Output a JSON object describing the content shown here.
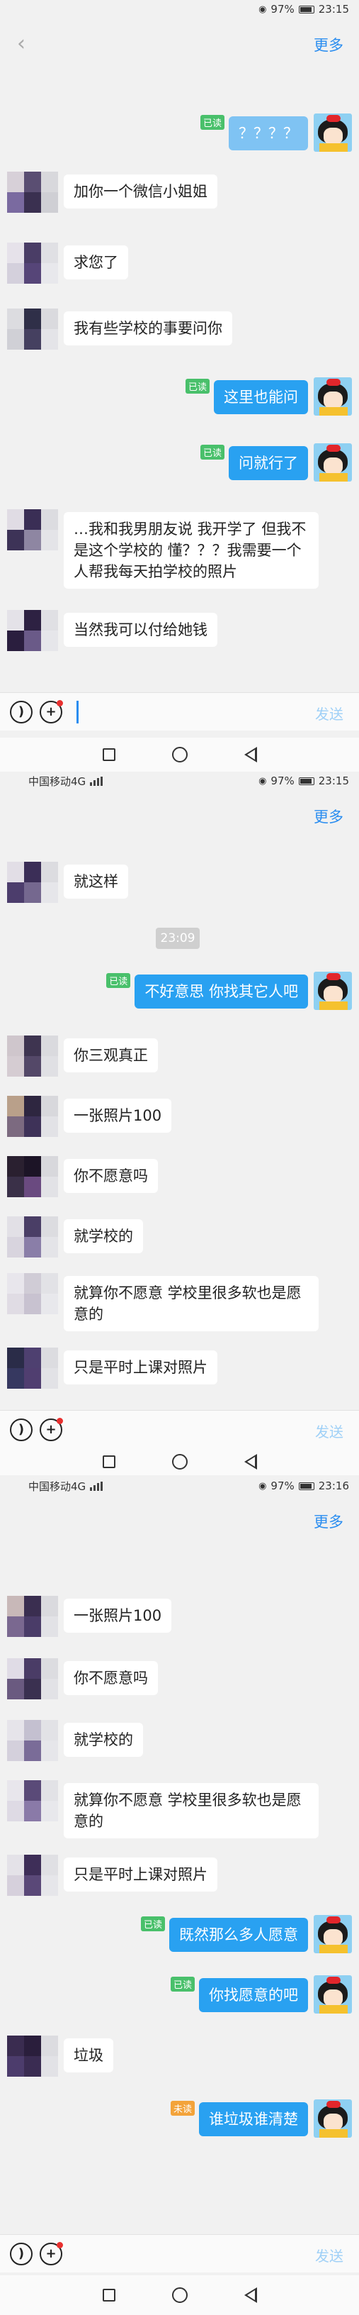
{
  "colors": {
    "accent": "#2a8df0",
    "bubble_out": "#29a1f1",
    "read_badge": "#49c06b",
    "unread_badge": "#f3a33a"
  },
  "screens": [
    {
      "status": {
        "carrier": "",
        "battery": "97%",
        "time": "23:15"
      },
      "more": "更多",
      "messages": [
        {
          "side": "right",
          "text": "？？？？",
          "badge": "已读"
        },
        {
          "side": "left",
          "text": "加你一个微信小姐姐"
        },
        {
          "side": "left",
          "text": "求您了"
        },
        {
          "side": "left",
          "text": "我有些学校的事要问你"
        },
        {
          "side": "right",
          "text": "这里也能问",
          "badge": "已读"
        },
        {
          "side": "right",
          "text": "问就行了",
          "badge": "已读"
        },
        {
          "side": "left",
          "text": "…我和我男朋友说 我开学了 但我不是这个学校的 懂？？？我需要一个人帮我每天拍学校的照片"
        },
        {
          "side": "left",
          "text": "当然我可以付给她钱"
        }
      ],
      "send": "发送"
    },
    {
      "status": {
        "carrier": "中国移动4G",
        "battery": "97%",
        "time": "23:15"
      },
      "more": "更多",
      "messages": [
        {
          "side": "left",
          "text": "就这样"
        },
        {
          "side": "right",
          "text": "不好意思 你找其它人吧",
          "badge": "已读"
        },
        {
          "side": "left",
          "text": "你三观真正"
        },
        {
          "side": "left",
          "text": "一张照片100"
        },
        {
          "side": "left",
          "text": "你不愿意吗"
        },
        {
          "side": "left",
          "text": "就学校的"
        },
        {
          "side": "left",
          "text": "就算你不愿意 学校里很多软也是愿意的"
        },
        {
          "side": "left",
          "text": "只是平时上课对照片"
        }
      ],
      "timestamp": "23:09",
      "send": "发送"
    },
    {
      "status": {
        "carrier": "中国移动4G",
        "battery": "97%",
        "time": "23:16"
      },
      "more": "更多",
      "messages": [
        {
          "side": "left",
          "text": "一张照片100"
        },
        {
          "side": "left",
          "text": "你不愿意吗"
        },
        {
          "side": "left",
          "text": "就学校的"
        },
        {
          "side": "left",
          "text": "就算你不愿意 学校里很多软也是愿意的"
        },
        {
          "side": "left",
          "text": "只是平时上课对照片"
        },
        {
          "side": "right",
          "text": "既然那么多人愿意",
          "badge": "已读"
        },
        {
          "side": "right",
          "text": "你找愿意的吧",
          "badge": "已读"
        },
        {
          "side": "left",
          "text": "垃圾"
        },
        {
          "side": "right",
          "text": "谁垃圾谁清楚",
          "badge": "未读"
        }
      ],
      "send": "发送"
    }
  ]
}
